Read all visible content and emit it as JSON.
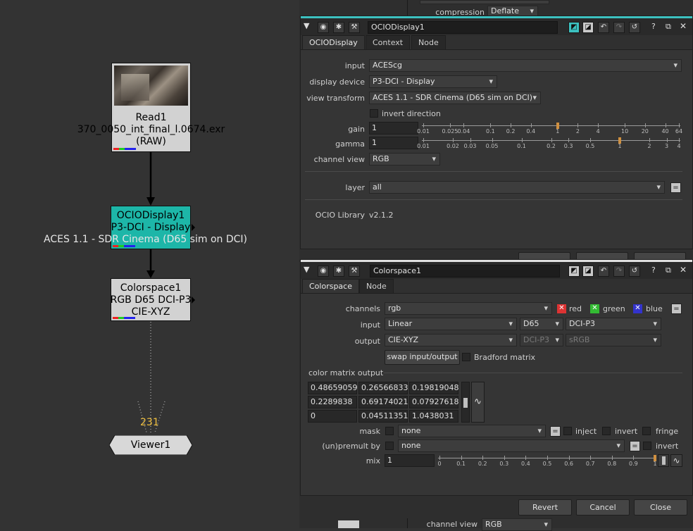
{
  "graph": {
    "read_node": {
      "line1": "Read1",
      "line2": "370_0050_int_final_l.0674.exr",
      "line3": "(RAW)"
    },
    "ocio_node": {
      "line1": "OCIODisplay1",
      "line2": "P3-DCI - Display",
      "line3": "ACES 1.1 - SDR Cinema (D65 sim on DCI)"
    },
    "cs_node": {
      "line1": "Colorspace1",
      "line2": "RGB D65 DCI-P3",
      "line3": "CIE-XYZ"
    },
    "viewer_inputs": "231",
    "viewer_node": "Viewer1"
  },
  "background_panel": {
    "compression_label": "compression",
    "compression_value": "Deflate"
  },
  "ocio_panel": {
    "name": "OCIODisplay1",
    "tabs": [
      "OCIODisplay",
      "Context",
      "Node"
    ],
    "input_label": "input",
    "input_value": "ACEScg",
    "display_device_label": "display device",
    "display_device_value": "P3-DCI - Display",
    "view_transform_label": "view transform",
    "view_transform_value": "ACES 1.1 - SDR Cinema (D65 sim on DCI)",
    "invert_direction_label": "invert direction",
    "gain_label": "gain",
    "gain_value": "1",
    "gain_ticks": [
      "0.01",
      "0.025",
      "0.04",
      "0.1",
      "0.2",
      "0.4",
      "1",
      "2",
      "4",
      "10",
      "20",
      "40",
      "64"
    ],
    "gamma_label": "gamma",
    "gamma_value": "1",
    "gamma_ticks": [
      "0.01",
      "0.02",
      "0.03",
      "0.05",
      "0.1",
      "0.2",
      "0.3",
      "0.5",
      "1",
      "2",
      "3",
      "4"
    ],
    "channel_view_label": "channel view",
    "channel_view_value": "RGB",
    "layer_label": "layer",
    "layer_value": "all",
    "ocio_library_label": "OCIO Library",
    "ocio_library_value": "v2.1.2"
  },
  "cs_panel": {
    "name": "Colorspace1",
    "tabs": [
      "Colorspace",
      "Node"
    ],
    "channels_label": "channels",
    "channels_value": "rgb",
    "red_label": "red",
    "green_label": "green",
    "blue_label": "blue",
    "input_label": "input",
    "input_value": "Linear",
    "input_illuminant": "D65",
    "input_primaries": "DCI-P3",
    "output_label": "output",
    "output_value": "CIE-XYZ",
    "output_illuminant": "DCI-P3",
    "output_primaries": "sRGB",
    "swap_label": "swap input/output",
    "bradford_label": "Bradford matrix",
    "matrix_label": "color matrix output",
    "matrix": [
      [
        "0.48659059",
        "0.26566833",
        "0.19819048"
      ],
      [
        "0.2289838",
        "0.69174021",
        "0.07927618"
      ],
      [
        "0",
        "0.04511351",
        "1.0438031"
      ]
    ],
    "mask_label": "mask",
    "mask_value": "none",
    "inject_label": "inject",
    "invert_label": "invert",
    "fringe_label": "fringe",
    "unpremult_label": "(un)premult by",
    "unpremult_value": "none",
    "invert2_label": "invert",
    "mix_label": "mix",
    "mix_value": "1",
    "mix_ticks": [
      "0",
      "0.1",
      "0.2",
      "0.3",
      "0.4",
      "0.5",
      "0.6",
      "0.7",
      "0.8",
      "0.9",
      "1"
    ]
  },
  "footer": {
    "revert": "Revert",
    "cancel": "Cancel",
    "close": "Close",
    "bottom_label": "channel view",
    "bottom_value": "RGB"
  },
  "colors": {
    "teal": "#3cc1c0",
    "node_teal": "#1db6a8",
    "knob": "#d09040"
  }
}
